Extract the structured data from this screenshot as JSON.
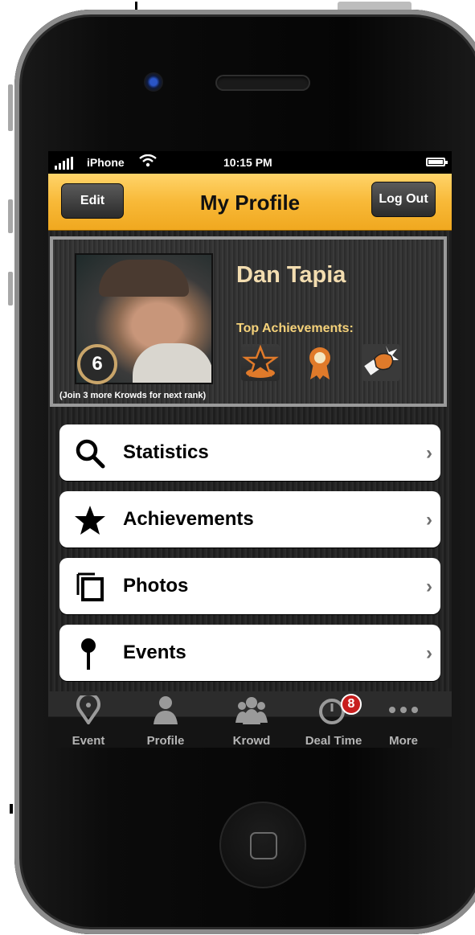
{
  "status": {
    "carrier": "iPhone",
    "time": "10:15 PM"
  },
  "nav": {
    "title": "My Profile",
    "edit_label": "Edit",
    "logout_label": "Log Out"
  },
  "profile": {
    "name": "Dan Tapia",
    "rank": "6",
    "rank_note": "(Join 3 more Krowds for next rank)",
    "achievements_title": "Top Achievements:",
    "badges": [
      "star-badge-icon",
      "ribbon-medal-icon",
      "punch-fist-icon"
    ]
  },
  "menu": [
    {
      "label": "Statistics",
      "icon": "search-icon"
    },
    {
      "label": "Achievements",
      "icon": "star-icon"
    },
    {
      "label": "Photos",
      "icon": "photos-icon"
    },
    {
      "label": "Events",
      "icon": "pin-icon"
    }
  ],
  "tabs": [
    {
      "label": "Event",
      "icon": "location-pin-icon"
    },
    {
      "label": "Profile",
      "icon": "person-icon"
    },
    {
      "label": "Krowd",
      "icon": "group-icon"
    },
    {
      "label": "Deal Time",
      "icon": "clock-icon",
      "badge": "8"
    },
    {
      "label": "More",
      "icon": "more-dots-icon"
    }
  ],
  "colors": {
    "navbar": "#f8b938",
    "title_text": "#f3ddb0",
    "badge_red": "#c81e1e"
  }
}
